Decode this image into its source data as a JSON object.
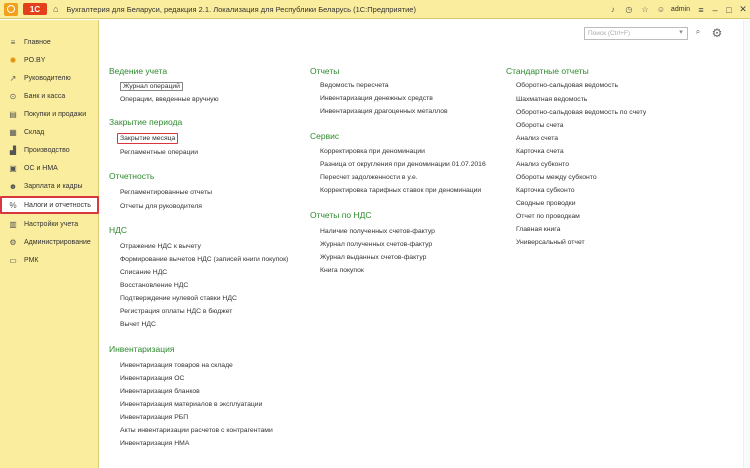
{
  "titlebar": {
    "logo": "1С",
    "title": "Бухгалтерия для Беларуси, редакция 2.1. Локализация для Республики Беларусь   (1С:Предприятие)",
    "user": "admin"
  },
  "sidebar": {
    "items": [
      {
        "label": "Главное",
        "icon": "menu-icon"
      },
      {
        "label": "PO.BY",
        "icon": "sun-icon"
      },
      {
        "label": "Руководителю",
        "icon": "chart-icon"
      },
      {
        "label": "Банк и касса",
        "icon": "bank-icon"
      },
      {
        "label": "Покупки и продажи",
        "icon": "cart-icon"
      },
      {
        "label": "Склад",
        "icon": "warehouse-icon"
      },
      {
        "label": "Производство",
        "icon": "factory-icon"
      },
      {
        "label": "ОС и НМА",
        "icon": "assets-icon"
      },
      {
        "label": "Зарплата и кадры",
        "icon": "people-icon"
      },
      {
        "label": "Налоги и отчетность",
        "icon": "taxes-icon"
      },
      {
        "label": "Настройки учета",
        "icon": "settings-icon"
      },
      {
        "label": "Администрирование",
        "icon": "gear-icon"
      },
      {
        "label": "РМК",
        "icon": "terminal-icon"
      }
    ]
  },
  "search": {
    "placeholder": "Поиск (Ctrl+F)"
  },
  "columns": {
    "col1": {
      "sections": [
        {
          "title": "Ведение учета",
          "links": [
            "Журнал операций",
            "Операции, введенные вручную"
          ]
        },
        {
          "title": "Закрытие периода",
          "links": [
            "Закрытие месяца",
            "Регламентные операции"
          ]
        },
        {
          "title": "Отчетность",
          "links": [
            "Регламентированные отчеты",
            "Отчеты для руководителя"
          ]
        },
        {
          "title": "НДС",
          "links": [
            "Отражение НДС к вычету",
            "Формирование вычетов НДС (записей книги покупок)",
            "Списание НДС",
            "Восстановление НДС",
            "Подтверждение нулевой ставки НДС",
            "Регистрация оплаты НДС в бюджет",
            "Вычет НДС"
          ]
        },
        {
          "title": "Инвентаризация",
          "links": [
            "Инвентаризация товаров на складе",
            "Инвентаризация ОС",
            "Инвентаризация бланков",
            "Инвентаризация материалов в эксплуатации",
            "Инвентаризация РБП",
            "Акты инвентаризации расчетов с контрагентами",
            "Инвентаризация НМА"
          ]
        }
      ]
    },
    "col2": {
      "sections": [
        {
          "title": "Отчеты",
          "links": [
            "Ведомость пересчета",
            "Инвентаризация денежных средств",
            "Инвентаризация драгоценных металлов"
          ]
        },
        {
          "title": "Сервис",
          "links": [
            "Корректировка при деноминации",
            "Разница от округления при деноминации 01.07.2016",
            "Пересчет задолженности в у.е.",
            "Корректировка тарифных ставок при деноминации"
          ]
        },
        {
          "title": "Отчеты по НДС",
          "links": [
            "Наличие полученных счетов-фактур",
            "Журнал полученных счетов-фактур",
            "Журнал выданных счетов-фактур",
            "Книга покупок"
          ]
        }
      ]
    },
    "col3": {
      "sections": [
        {
          "title": "Стандартные отчеты",
          "links": [
            "Оборотно-сальдовая ведомость",
            "Шахматная ведомость",
            "Оборотно-сальдовая ведомость по счету",
            "Обороты счета",
            "Анализ счета",
            "Карточка счета",
            "Анализ субконто",
            "Обороты между субконто",
            "Карточка субконто",
            "Сводные проводки",
            "Отчет по проводкам",
            "Главная книга",
            "Универсальный отчет"
          ]
        }
      ]
    }
  },
  "colors": {
    "accent_green": "#2d8a2d",
    "sidebar_bg": "#fbed9e",
    "highlight_red": "#d9363e"
  }
}
